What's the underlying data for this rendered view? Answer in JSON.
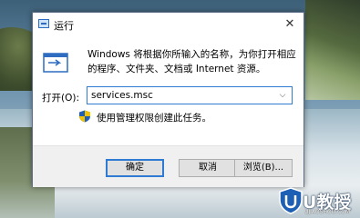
{
  "dialog": {
    "title": "运行",
    "close_glyph": "✕",
    "message": "Windows 将根据你所输入的名称，为你打开相应的程序、文件夹、文档或 Internet 资源。",
    "open_label": "打开(O):",
    "input_value": "services.msc",
    "dropdown_glyph": "⌵",
    "admin_note": "使用管理权限创建此任务。",
    "buttons": {
      "ok": "确定",
      "cancel": "取消",
      "browse": "浏览(B)..."
    }
  },
  "watermark": {
    "brand": "U教授",
    "url": "UJIAOSHOU.COM"
  },
  "icons": {
    "app": "run-dialog-icon",
    "run": "run-program-icon",
    "shield": "uac-shield-icon",
    "close": "close-icon",
    "dropdown": "chevron-down-icon"
  },
  "colors": {
    "accent_blue": "#2f7bd4",
    "footer_bg": "#f0f0f0",
    "button_bg": "#e1e1e1"
  }
}
